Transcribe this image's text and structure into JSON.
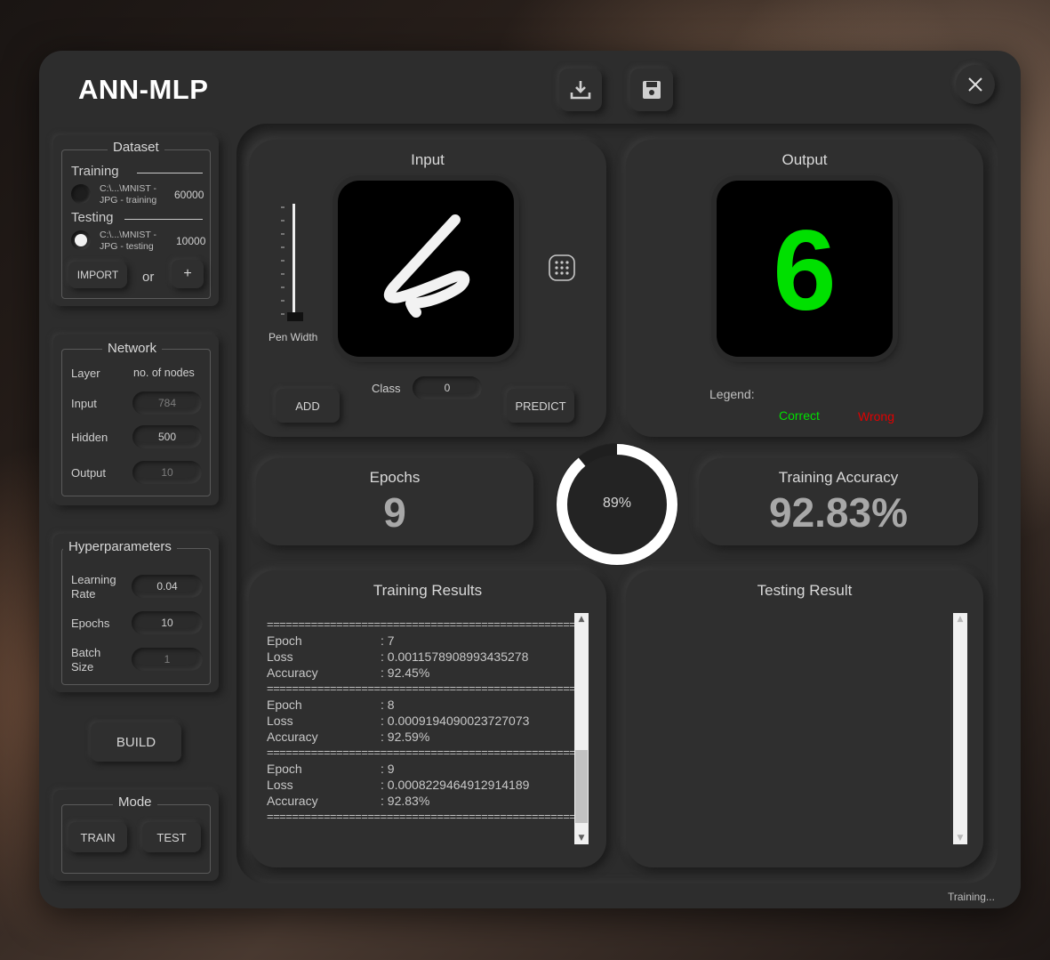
{
  "app": {
    "title": "ANN-MLP",
    "status": "Training..."
  },
  "toolbar": {
    "download_icon": "download-icon",
    "save_icon": "floppy-save-icon",
    "close_icon": "close-icon"
  },
  "dataset": {
    "title": "Dataset",
    "training": {
      "label": "Training",
      "path": "C:\\...\\MNIST -\nJPG - training",
      "count": "60000"
    },
    "testing": {
      "label": "Testing",
      "path": "C:\\...\\MNIST -\nJPG - testing",
      "count": "10000"
    },
    "import_label": "IMPORT",
    "or_label": "or",
    "add_label": "+"
  },
  "network": {
    "title": "Network",
    "col_layer": "Layer",
    "col_nodes": "no. of nodes",
    "rows": [
      {
        "label": "Input",
        "value": "784"
      },
      {
        "label": "Hidden",
        "value": "500"
      },
      {
        "label": "Output",
        "value": "10"
      }
    ]
  },
  "hyperparameters": {
    "title": "Hyperparameters",
    "learning_rate_label": "Learning\nRate",
    "learning_rate": "0.04",
    "epochs_label": "Epochs",
    "epochs": "10",
    "batch_label": "Batch\nSize",
    "batch": "1"
  },
  "build_label": "BUILD",
  "mode": {
    "title": "Mode",
    "train_label": "TRAIN",
    "test_label": "TEST"
  },
  "input_panel": {
    "title": "Input",
    "pen_width_label": "Pen Width",
    "class_label": "Class",
    "class_value": "0",
    "add_label": "ADD",
    "predict_label": "PREDICT",
    "grid_icon": "grid-dots-icon"
  },
  "output_panel": {
    "title": "Output",
    "digit": "6",
    "legend_label": "Legend:",
    "correct_label": "Correct",
    "wrong_label": "Wrong",
    "correct_color": "#00e000",
    "wrong_color": "#e00000"
  },
  "epochs_card": {
    "title": "Epochs",
    "value": "9"
  },
  "progress": {
    "label": "89%",
    "fraction": 0.89
  },
  "accuracy_card": {
    "title": "Training Accuracy",
    "value": "92.83%"
  },
  "training_results": {
    "title": "Training Results",
    "separator": "=================================================",
    "entries": [
      {
        "epoch_label": "Epoch",
        "epoch": ": 7",
        "loss_label": "Loss",
        "loss": ": 0.0011578908993435278",
        "acc_label": "Accuracy",
        "acc": ": 92.45%"
      },
      {
        "epoch_label": "Epoch",
        "epoch": ": 8",
        "loss_label": "Loss",
        "loss": ": 0.0009194090023727073",
        "acc_label": "Accuracy",
        "acc": ": 92.59%"
      },
      {
        "epoch_label": "Epoch",
        "epoch": ": 9",
        "loss_label": "Loss",
        "loss": ": 0.0008229464912914189",
        "acc_label": "Accuracy",
        "acc": ": 92.83%"
      }
    ]
  },
  "testing_result": {
    "title": "Testing Result"
  }
}
